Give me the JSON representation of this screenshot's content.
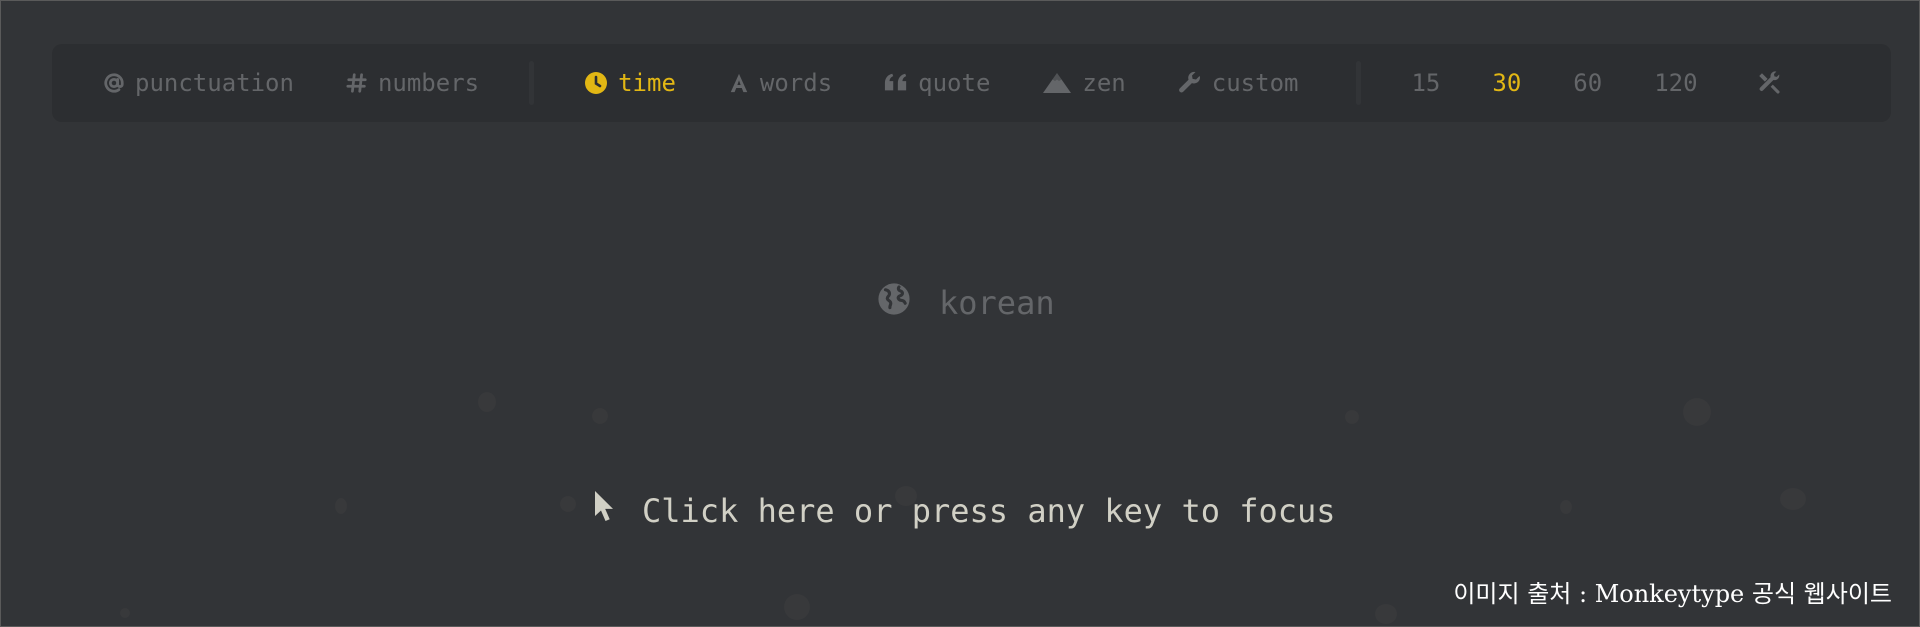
{
  "config_bar": {
    "modifiers": [
      {
        "icon": "at-icon",
        "label": "punctuation",
        "active": false
      },
      {
        "icon": "hash-icon",
        "label": "numbers",
        "active": false
      }
    ],
    "modes": [
      {
        "icon": "clock-icon",
        "label": "time",
        "active": true
      },
      {
        "icon": "font-icon",
        "label": "words",
        "active": false
      },
      {
        "icon": "quote-icon",
        "label": "quote",
        "active": false
      },
      {
        "icon": "mountain-icon",
        "label": "zen",
        "active": false
      },
      {
        "icon": "wrench-icon",
        "label": "custom",
        "active": false
      }
    ],
    "durations": [
      "15",
      "30",
      "60",
      "120"
    ],
    "selected_duration": "30",
    "settings_icon": "tools-icon"
  },
  "language": {
    "icon": "globe-icon",
    "label": "korean"
  },
  "focus_prompt": {
    "icon": "mouse-pointer-icon",
    "label": "Click here or press any key to focus"
  },
  "caption": "이미지 출처 : Monkeytype 공식 웹사이트",
  "colors": {
    "background": "#323437",
    "bar": "#2c2e31",
    "muted": "#646669",
    "accent": "#e2b714",
    "text": "#d1d0c5"
  }
}
